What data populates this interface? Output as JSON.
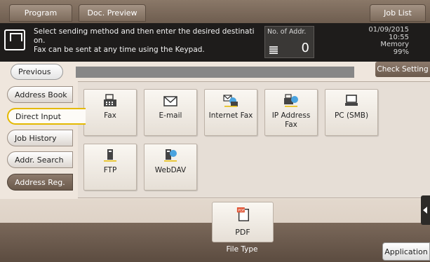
{
  "topbar": {
    "program_label": "Program",
    "docpreview_label": "Doc. Preview",
    "joblist_label": "Job List"
  },
  "message": {
    "text": "Select sending method and then enter the desired destinati\non.\nFax can be sent at any time using the Keypad.",
    "addr_label": "No. of Addr.",
    "addr_count": "0"
  },
  "status": {
    "date": "01/09/2015",
    "time": "10:55",
    "memory_label": "Memory",
    "memory_value": "99%"
  },
  "nav": {
    "previous_label": "Previous",
    "tabs": [
      {
        "label": "Address Book"
      },
      {
        "label": "Direct Input"
      },
      {
        "label": "Job History"
      },
      {
        "label": "Addr. Search"
      }
    ],
    "address_reg_label": "Address Reg.",
    "check_setting_label": "Check Setting"
  },
  "tiles": [
    {
      "label": "Fax",
      "icon": "fax-icon"
    },
    {
      "label": "E-mail",
      "icon": "email-icon"
    },
    {
      "label": "Internet Fax",
      "icon": "internet-fax-icon"
    },
    {
      "label": "IP Address\nFax",
      "icon": "ip-address-fax-icon"
    },
    {
      "label": "PC (SMB)",
      "icon": "pc-smb-icon"
    },
    {
      "label": "FTP",
      "icon": "ftp-icon"
    },
    {
      "label": "WebDAV",
      "icon": "webdav-icon"
    }
  ],
  "filetype": {
    "button_label": "PDF",
    "caption": "File Type",
    "icon": "pdf-icon"
  },
  "application_label": "Application",
  "colors": {
    "accent_yellow": "#e4b900",
    "frame_brown": "#6b5a4c",
    "message_bg": "#1e1c1b"
  }
}
